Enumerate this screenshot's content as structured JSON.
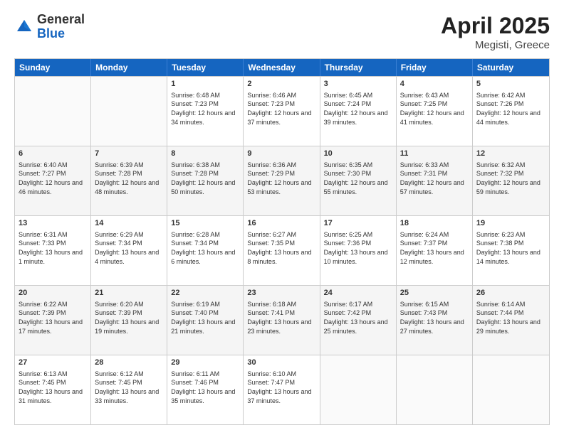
{
  "header": {
    "logo_general": "General",
    "logo_blue": "Blue",
    "main_title": "April 2025",
    "subtitle": "Megisti, Greece"
  },
  "calendar": {
    "days_of_week": [
      "Sunday",
      "Monday",
      "Tuesday",
      "Wednesday",
      "Thursday",
      "Friday",
      "Saturday"
    ],
    "rows": [
      [
        {
          "day": "",
          "empty": true
        },
        {
          "day": "",
          "empty": true
        },
        {
          "day": "1",
          "sunrise": "6:48 AM",
          "sunset": "7:23 PM",
          "daylight": "12 hours and 34 minutes."
        },
        {
          "day": "2",
          "sunrise": "6:46 AM",
          "sunset": "7:23 PM",
          "daylight": "12 hours and 37 minutes."
        },
        {
          "day": "3",
          "sunrise": "6:45 AM",
          "sunset": "7:24 PM",
          "daylight": "12 hours and 39 minutes."
        },
        {
          "day": "4",
          "sunrise": "6:43 AM",
          "sunset": "7:25 PM",
          "daylight": "12 hours and 41 minutes."
        },
        {
          "day": "5",
          "sunrise": "6:42 AM",
          "sunset": "7:26 PM",
          "daylight": "12 hours and 44 minutes."
        }
      ],
      [
        {
          "day": "6",
          "sunrise": "6:40 AM",
          "sunset": "7:27 PM",
          "daylight": "12 hours and 46 minutes."
        },
        {
          "day": "7",
          "sunrise": "6:39 AM",
          "sunset": "7:28 PM",
          "daylight": "12 hours and 48 minutes."
        },
        {
          "day": "8",
          "sunrise": "6:38 AM",
          "sunset": "7:28 PM",
          "daylight": "12 hours and 50 minutes."
        },
        {
          "day": "9",
          "sunrise": "6:36 AM",
          "sunset": "7:29 PM",
          "daylight": "12 hours and 53 minutes."
        },
        {
          "day": "10",
          "sunrise": "6:35 AM",
          "sunset": "7:30 PM",
          "daylight": "12 hours and 55 minutes."
        },
        {
          "day": "11",
          "sunrise": "6:33 AM",
          "sunset": "7:31 PM",
          "daylight": "12 hours and 57 minutes."
        },
        {
          "day": "12",
          "sunrise": "6:32 AM",
          "sunset": "7:32 PM",
          "daylight": "12 hours and 59 minutes."
        }
      ],
      [
        {
          "day": "13",
          "sunrise": "6:31 AM",
          "sunset": "7:33 PM",
          "daylight": "13 hours and 1 minute."
        },
        {
          "day": "14",
          "sunrise": "6:29 AM",
          "sunset": "7:34 PM",
          "daylight": "13 hours and 4 minutes."
        },
        {
          "day": "15",
          "sunrise": "6:28 AM",
          "sunset": "7:34 PM",
          "daylight": "13 hours and 6 minutes."
        },
        {
          "day": "16",
          "sunrise": "6:27 AM",
          "sunset": "7:35 PM",
          "daylight": "13 hours and 8 minutes."
        },
        {
          "day": "17",
          "sunrise": "6:25 AM",
          "sunset": "7:36 PM",
          "daylight": "13 hours and 10 minutes."
        },
        {
          "day": "18",
          "sunrise": "6:24 AM",
          "sunset": "7:37 PM",
          "daylight": "13 hours and 12 minutes."
        },
        {
          "day": "19",
          "sunrise": "6:23 AM",
          "sunset": "7:38 PM",
          "daylight": "13 hours and 14 minutes."
        }
      ],
      [
        {
          "day": "20",
          "sunrise": "6:22 AM",
          "sunset": "7:39 PM",
          "daylight": "13 hours and 17 minutes."
        },
        {
          "day": "21",
          "sunrise": "6:20 AM",
          "sunset": "7:39 PM",
          "daylight": "13 hours and 19 minutes."
        },
        {
          "day": "22",
          "sunrise": "6:19 AM",
          "sunset": "7:40 PM",
          "daylight": "13 hours and 21 minutes."
        },
        {
          "day": "23",
          "sunrise": "6:18 AM",
          "sunset": "7:41 PM",
          "daylight": "13 hours and 23 minutes."
        },
        {
          "day": "24",
          "sunrise": "6:17 AM",
          "sunset": "7:42 PM",
          "daylight": "13 hours and 25 minutes."
        },
        {
          "day": "25",
          "sunrise": "6:15 AM",
          "sunset": "7:43 PM",
          "daylight": "13 hours and 27 minutes."
        },
        {
          "day": "26",
          "sunrise": "6:14 AM",
          "sunset": "7:44 PM",
          "daylight": "13 hours and 29 minutes."
        }
      ],
      [
        {
          "day": "27",
          "sunrise": "6:13 AM",
          "sunset": "7:45 PM",
          "daylight": "13 hours and 31 minutes."
        },
        {
          "day": "28",
          "sunrise": "6:12 AM",
          "sunset": "7:45 PM",
          "daylight": "13 hours and 33 minutes."
        },
        {
          "day": "29",
          "sunrise": "6:11 AM",
          "sunset": "7:46 PM",
          "daylight": "13 hours and 35 minutes."
        },
        {
          "day": "30",
          "sunrise": "6:10 AM",
          "sunset": "7:47 PM",
          "daylight": "13 hours and 37 minutes."
        },
        {
          "day": "",
          "empty": true
        },
        {
          "day": "",
          "empty": true
        },
        {
          "day": "",
          "empty": true
        }
      ]
    ],
    "labels": {
      "sunrise": "Sunrise:",
      "sunset": "Sunset:",
      "daylight": "Daylight:"
    }
  }
}
